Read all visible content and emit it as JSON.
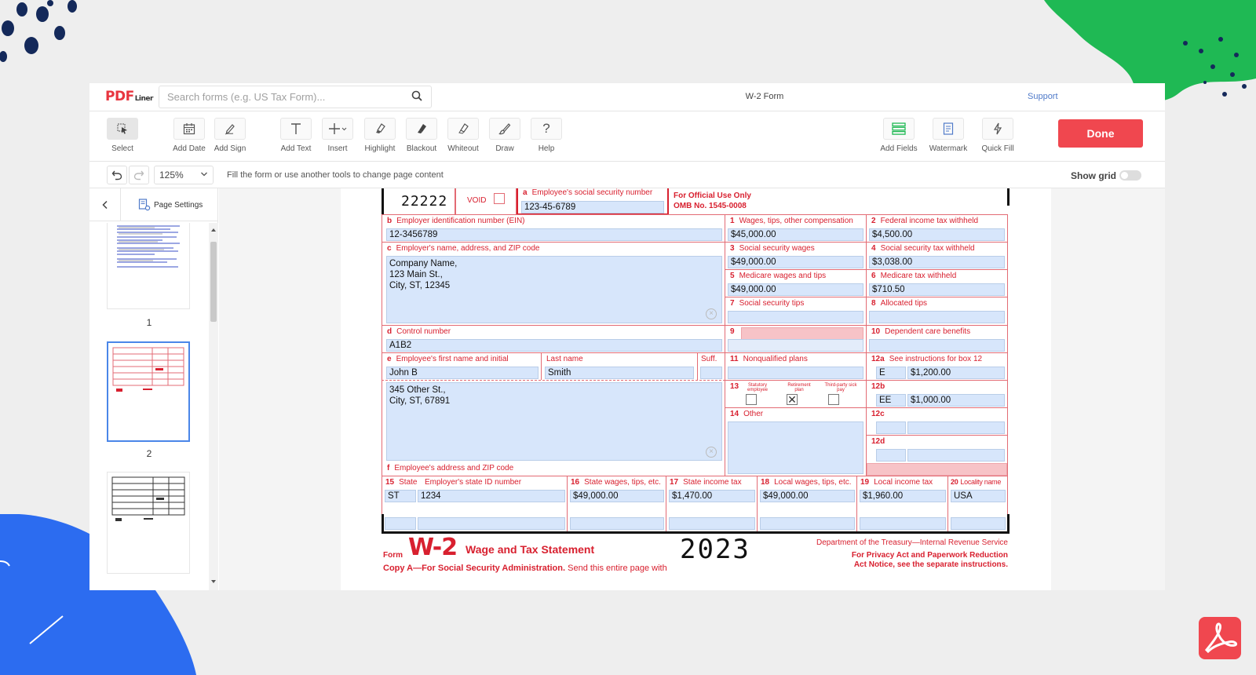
{
  "colors": {
    "accent": "#f0474f",
    "link": "#4f7ac9",
    "form_red": "#d8202f",
    "field_fill": "#d7e6fb",
    "field_pink": "#f7c3c7",
    "decor_green": "#1fb954",
    "decor_blue": "#2c6cf0",
    "decor_navy": "#14295a"
  },
  "header": {
    "logo_main": "PDF",
    "logo_sub": "Liner",
    "search_placeholder": "Search forms (e.g. US Tax Form)...",
    "doc_title": "W-2 Form",
    "support": "Support"
  },
  "toolbar": {
    "tools": [
      {
        "label": "Select",
        "icon": "cursor-icon"
      },
      {
        "label": "Add Date",
        "icon": "calendar-icon"
      },
      {
        "label": "Add Sign",
        "icon": "pen-sign-icon"
      },
      {
        "label": "Add Text",
        "icon": "text-icon"
      },
      {
        "label": "Insert",
        "icon": "plus-icon"
      },
      {
        "label": "Highlight",
        "icon": "highlighter-icon"
      },
      {
        "label": "Blackout",
        "icon": "blackout-icon"
      },
      {
        "label": "Whiteout",
        "icon": "whiteout-icon"
      },
      {
        "label": "Draw",
        "icon": "brush-icon"
      },
      {
        "label": "Help",
        "icon": "question-icon"
      },
      {
        "label": "Add Fields",
        "icon": "fields-icon"
      },
      {
        "label": "Watermark",
        "icon": "watermark-icon"
      },
      {
        "label": "Quick Fill",
        "icon": "lightning-icon"
      }
    ],
    "done": "Done"
  },
  "subbar": {
    "zoom": "125%",
    "hint": "Fill the form or use another tools to change page content",
    "show_grid": "Show grid",
    "show_grid_on": false
  },
  "sidebar": {
    "page_settings": "Page Settings",
    "pages": [
      "1",
      "2",
      "3"
    ],
    "selected_page": "2"
  },
  "form": {
    "code": "22222",
    "void": "VOID",
    "ssn_label": "Employee's social security number",
    "ssn_letter": "a",
    "ssn": "123-45-6789",
    "official_1": "For Official Use Only",
    "official_2": "OMB No. 1545-0008",
    "b_label": "Employer identification number (EIN)",
    "b_value": "12-3456789",
    "c_label": "Employer's name, address, and ZIP code",
    "c_value": "Company Name,\n123 Main St.,\nCity, ST, 12345",
    "d_label": "Control number",
    "d_value": "A1B2",
    "e_label": "Employee's first name and initial",
    "e_value": "John B",
    "last_label": "Last name",
    "last_value": "Smith",
    "suff_label": "Suff.",
    "address_value": "345 Other St.,\nCity, ST, 67891",
    "f_label": "Employee's address and ZIP code",
    "box1_label": "Wages, tips, other compensation",
    "box1": "$45,000.00",
    "box2_label": "Federal income tax withheld",
    "box2": "$4,500.00",
    "box3_label": "Social security wages",
    "box3": "$49,000.00",
    "box4_label": "Social security tax withheld",
    "box4": "$3,038.00",
    "box5_label": "Medicare wages and tips",
    "box5": "$49,000.00",
    "box6_label": "Medicare tax withheld",
    "box6": "$710.50",
    "box7_label": "Social security tips",
    "box7": "",
    "box8_label": "Allocated tips",
    "box8": "",
    "box9": "",
    "box10_label": "Dependent care benefits",
    "box10": "",
    "box11_label": "Nonqualified plans",
    "box11": "",
    "box12a_label": "See instructions for box 12",
    "box12a_code": "E",
    "box12a_amount": "$1,200.00",
    "box12b_code": "EE",
    "box12b_amount": "$1,000.00",
    "box12c_code": "",
    "box12c_amount": "",
    "box12d_code": "",
    "box12d_amount": "",
    "box13_statutory": "Statutory employee",
    "box13_retirement": "Retirement plan",
    "box13_thirdparty": "Third-party sick pay",
    "box13_retirement_checked": true,
    "box14_label": "Other",
    "box15_label": "State",
    "box15_id_label": "Employer's state ID number",
    "box15_state": "ST",
    "box15_id": "1234",
    "box16_label": "State wages, tips, etc.",
    "box16": "$49,000.00",
    "box17_label": "State income tax",
    "box17": "$1,470.00",
    "box18_label": "Local wages, tips, etc.",
    "box18": "$49,000.00",
    "box19_label": "Local income tax",
    "box19": "$1,960.00",
    "box20_label": "Locality name",
    "box20": "USA",
    "footer_form": "Form",
    "footer_w2": "W-2",
    "footer_title": "Wage and Tax Statement",
    "footer_year": "2023",
    "footer_dept": "Department of the Treasury—Internal Revenue Service",
    "footer_privacy_1": "For Privacy Act and Paperwork Reduction",
    "footer_privacy_2": "Act Notice, see the separate instructions.",
    "footer_copy_bold": "Copy A—For Social Security Administration.",
    "footer_copy_rest": "Send this entire page with"
  }
}
